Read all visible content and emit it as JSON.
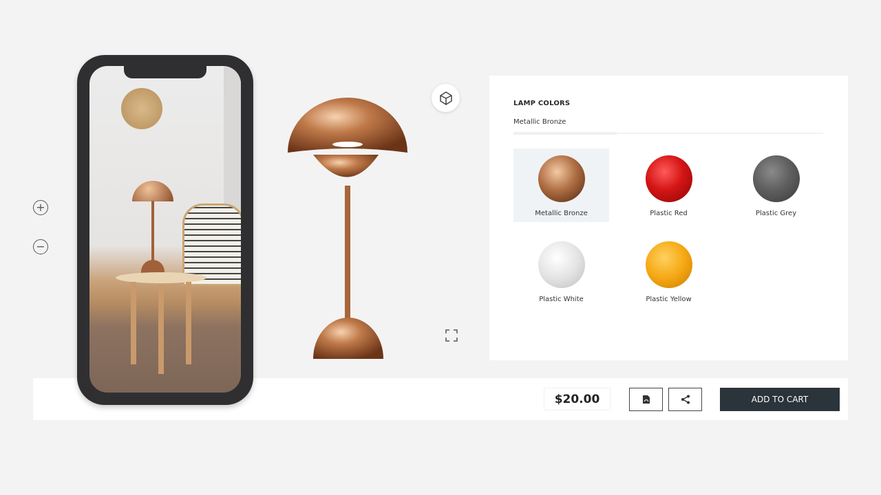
{
  "viewer": {
    "zoom_in": "+",
    "zoom_out": "−",
    "ar_icon": "ar-cube-icon",
    "fullscreen_icon": "fullscreen-icon"
  },
  "panel": {
    "title": "LAMP COLORS",
    "selected": "Metallic Bronze",
    "swatches": [
      {
        "label": "Metallic Bronze",
        "color": "#a0603a",
        "selected": true
      },
      {
        "label": "Plastic Red",
        "color": "#d41515",
        "selected": false
      },
      {
        "label": "Plastic Grey",
        "color": "#5f5f5f",
        "selected": false
      },
      {
        "label": "Plastic White",
        "color": "#e4e4e4",
        "selected": false
      },
      {
        "label": "Plastic Yellow",
        "color": "#f5a813",
        "selected": false
      }
    ]
  },
  "footer": {
    "price": "$20.00",
    "pdf_icon": "pdf-icon",
    "share_icon": "share-icon",
    "add_to_cart": "ADD TO CART"
  },
  "colors": {
    "cart_bg": "#2b333b",
    "bronze": "#b06f44"
  }
}
